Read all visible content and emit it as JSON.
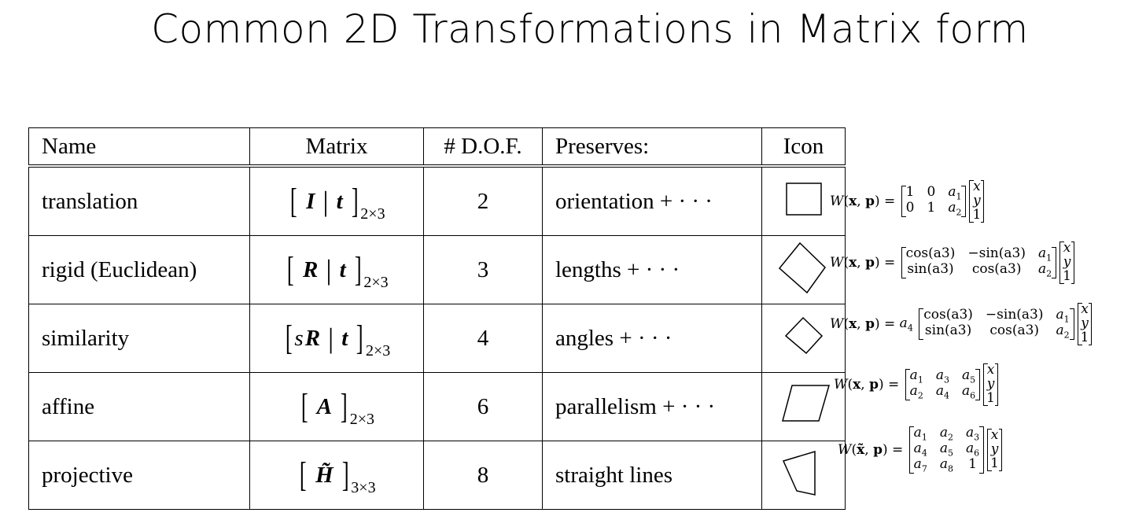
{
  "title": "Common 2D Transformations in Matrix form",
  "table": {
    "headers": [
      "Name",
      "Matrix",
      "# D.O.F.",
      "Preserves:",
      "Icon"
    ],
    "rows": [
      {
        "name": "translation",
        "matrix": {
          "scalar": "",
          "left": "I",
          "right": "t",
          "size": "2×3"
        },
        "dof": "2",
        "preserves": "orientation + · · ·",
        "icon": "square-icon"
      },
      {
        "name": "rigid (Euclidean)",
        "matrix": {
          "scalar": "",
          "left": "R",
          "right": "t",
          "size": "2×3"
        },
        "dof": "3",
        "preserves": "lengths + · · ·",
        "icon": "rotated-square-icon"
      },
      {
        "name": "similarity",
        "matrix": {
          "scalar": "s",
          "left": "R",
          "right": "t",
          "size": "2×3"
        },
        "dof": "4",
        "preserves": "angles + · · ·",
        "icon": "small-rotated-square-icon"
      },
      {
        "name": "affine",
        "matrix": {
          "scalar": "",
          "left": "A",
          "right": "",
          "size": "2×3"
        },
        "dof": "6",
        "preserves": "parallelism + · · ·",
        "icon": "parallelogram-icon"
      },
      {
        "name": "projective",
        "matrix": {
          "scalar": "",
          "left": "H̃",
          "right": "",
          "size": "3×3"
        },
        "dof": "8",
        "preserves": "straight lines",
        "icon": "trapezoid-icon"
      }
    ]
  },
  "equations": [
    {
      "fn": "W",
      "arg1": "x",
      "arg2": "p",
      "eq": "=",
      "scalar": "",
      "matrix": [
        [
          "1",
          "0",
          "a1"
        ],
        [
          "0",
          "1",
          "a2"
        ]
      ],
      "vector": [
        "x",
        "y",
        "1"
      ]
    },
    {
      "fn": "W",
      "arg1": "x",
      "arg2": "p",
      "eq": "=",
      "scalar": "",
      "matrix": [
        [
          "cos(a3)",
          "−sin(a3)",
          "a1"
        ],
        [
          "sin(a3)",
          "cos(a3)",
          "a2"
        ]
      ],
      "vector": [
        "x",
        "y",
        "1"
      ]
    },
    {
      "fn": "W",
      "arg1": "x",
      "arg2": "p",
      "eq": "=",
      "scalar": "a4",
      "matrix": [
        [
          "cos(a3)",
          "−sin(a3)",
          "a1"
        ],
        [
          "sin(a3)",
          "cos(a3)",
          "a2"
        ]
      ],
      "vector": [
        "x",
        "y",
        "1"
      ]
    },
    {
      "fn": "W",
      "arg1": "x",
      "arg2": "p",
      "eq": "=",
      "scalar": "",
      "matrix": [
        [
          "a1",
          "a3",
          "a5"
        ],
        [
          "a2",
          "a4",
          "a6"
        ]
      ],
      "vector": [
        "x",
        "y",
        "1"
      ]
    },
    {
      "fn": "W",
      "arg1": "x̃",
      "arg2": "p",
      "eq": "=",
      "scalar": "",
      "matrix": [
        [
          "a1",
          "a2",
          "a3"
        ],
        [
          "a4",
          "a5",
          "a6"
        ],
        [
          "a7",
          "a8",
          "1"
        ]
      ],
      "vector": [
        "x",
        "y",
        "1"
      ]
    }
  ]
}
